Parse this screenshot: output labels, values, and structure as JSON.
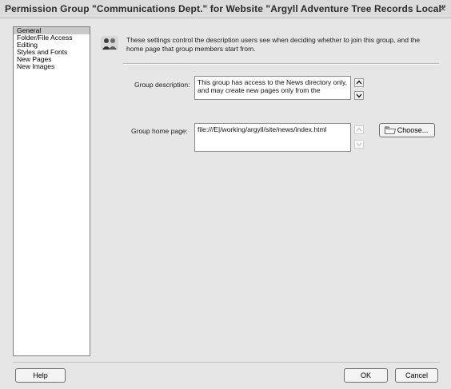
{
  "window": {
    "title": "Permission Group \"Communications Dept.\" for Website \"Argyll Adventure Tree Records Local\""
  },
  "sidebar": {
    "items": [
      {
        "label": "General",
        "selected": true
      },
      {
        "label": "Folder/File Access",
        "selected": false
      },
      {
        "label": "Editing",
        "selected": false
      },
      {
        "label": "Styles and Fonts",
        "selected": false
      },
      {
        "label": "New Pages",
        "selected": false
      },
      {
        "label": "New Images",
        "selected": false
      }
    ]
  },
  "info": {
    "text": "These settings control the description users see when deciding whether to join this group, and the home page that group members start from.",
    "icon": "group-people-icon"
  },
  "form": {
    "description_label": "Group description:",
    "description_value": "This group has access to the News directory only, and may create new pages only from the",
    "home_label": "Group home page:",
    "home_value": "file:///E|/working/argyll/site/news/index.html",
    "choose_label": "Choose..."
  },
  "buttons": {
    "help": "Help",
    "ok": "OK",
    "cancel": "Cancel"
  }
}
